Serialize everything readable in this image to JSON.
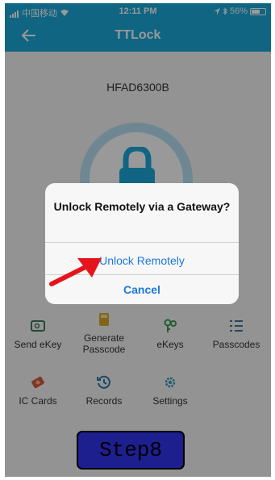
{
  "status_bar": {
    "carrier": "中国移动",
    "time": "12:11 PM",
    "battery": "56%"
  },
  "nav": {
    "title": "TTLock"
  },
  "lock": {
    "name": "HFAD6300B"
  },
  "menu": [
    {
      "label": "Send eKey",
      "icon": "send-ekey-icon"
    },
    {
      "label": "Generate Passcode",
      "icon": "calculator-icon"
    },
    {
      "label": "eKeys",
      "icon": "keys-icon"
    },
    {
      "label": "Passcodes",
      "icon": "list-icon"
    },
    {
      "label": "IC Cards",
      "icon": "ic-card-icon"
    },
    {
      "label": "Records",
      "icon": "history-icon"
    },
    {
      "label": "Settings",
      "icon": "gear-icon"
    }
  ],
  "alert": {
    "message": "Unlock Remotely via a Gateway?",
    "confirm_label": "Unlock Remotely",
    "cancel_label": "Cancel"
  },
  "step_badge": "Step8",
  "colors": {
    "brand": "#1aa8d9",
    "alert_button": "#1a78e0",
    "annotation_arrow": "#e5161b",
    "step_badge": "#1e1f8f"
  }
}
